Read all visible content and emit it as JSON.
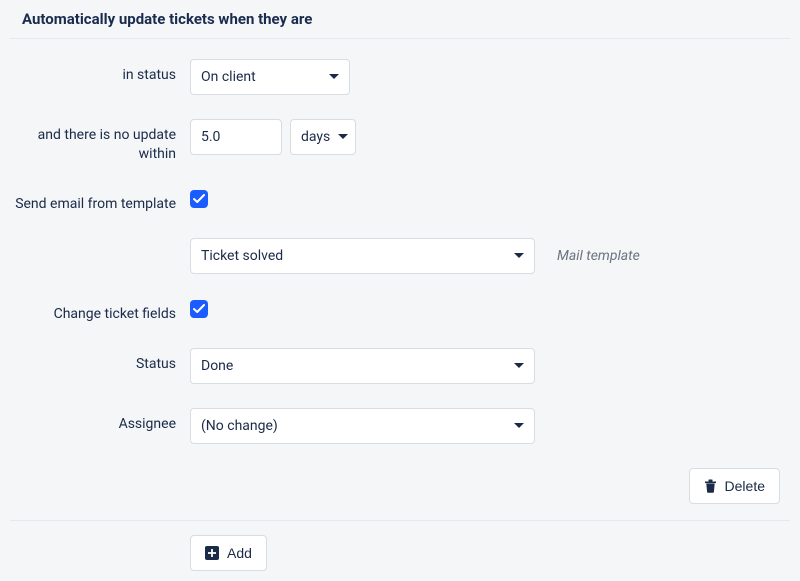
{
  "section": {
    "title": "Automatically update tickets when they are"
  },
  "labels": {
    "in_status": "in status",
    "no_update": "and there is no update within",
    "send_email": "Send email from template",
    "change_fields": "Change ticket fields",
    "status": "Status",
    "assignee": "Assignee"
  },
  "values": {
    "status_dropdown": "On client",
    "duration_number": "5.0",
    "duration_unit": "days",
    "email_template": "Ticket solved",
    "change_status": "Done",
    "change_assignee": "(No change)"
  },
  "hints": {
    "mail_template": "Mail template"
  },
  "buttons": {
    "delete": "Delete",
    "add": "Add"
  }
}
